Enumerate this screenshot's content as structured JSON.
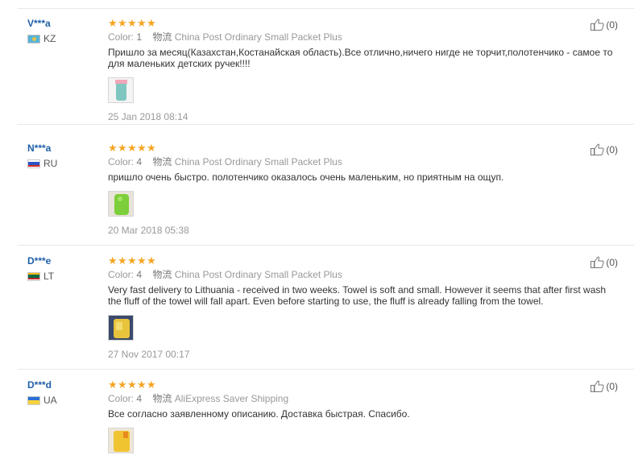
{
  "reviews": [
    {
      "user": "V***a",
      "country": "KZ",
      "flag_colors": [
        "#56b4d9",
        "#e6c34a"
      ],
      "stars": 5,
      "color_label": "Color:",
      "color_value": "1",
      "shipping_label": "物流",
      "shipping_value": "China Post Ordinary Small Packet Plus",
      "text": "Пришло за месяц(Казахстан,Костанайская область).Все отлично,ничего нигде не торчит,полотенчико - самое то для маленьких детских ручек!!!!",
      "photo_icon": "towel-photo-pink",
      "date": "25 Jan 2018 08:14",
      "helpful": "(0)"
    },
    {
      "user": "N***a",
      "country": "RU",
      "flag_colors": [
        "#ffffff",
        "#2a55c7",
        "#d52b1e"
      ],
      "stars": 5,
      "color_label": "Color:",
      "color_value": "4",
      "shipping_label": "物流",
      "shipping_value": "China Post Ordinary Small Packet Plus",
      "text": "пришло очень быстро. полотенчико оказалось очень маленьким, но приятным на ощуп.",
      "photo_icon": "towel-photo-green",
      "date": "20 Mar 2018 05:38",
      "helpful": "(0)"
    },
    {
      "user": "D***e",
      "country": "LT",
      "flag_colors": [
        "#fdb913",
        "#006a44",
        "#c1272d"
      ],
      "stars": 5,
      "color_label": "Color:",
      "color_value": "4",
      "shipping_label": "物流",
      "shipping_value": "China Post Ordinary Small Packet Plus",
      "text": "Very fast delivery to Lithuania - received in two weeks. Towel is soft and small. However it seems that after first wash the fluff of the towel will fall apart. Even before starting to use, the fluff is already falling from the towel.",
      "photo_icon": "towel-photo-yellow",
      "date": "27 Nov 2017 00:17",
      "helpful": "(0)"
    },
    {
      "user": "D***d",
      "country": "UA",
      "flag_colors": [
        "#2b6fd6",
        "#f7d33a"
      ],
      "stars": 5,
      "color_label": "Color:",
      "color_value": "4",
      "shipping_label": "物流",
      "shipping_value": "AliExpress Saver Shipping",
      "text": "Все согласно заявленному описанию. Доставка быстрая. Спасибо.",
      "photo_icon": "towel-photo-yellow",
      "date": "",
      "helpful": "(0)"
    }
  ]
}
